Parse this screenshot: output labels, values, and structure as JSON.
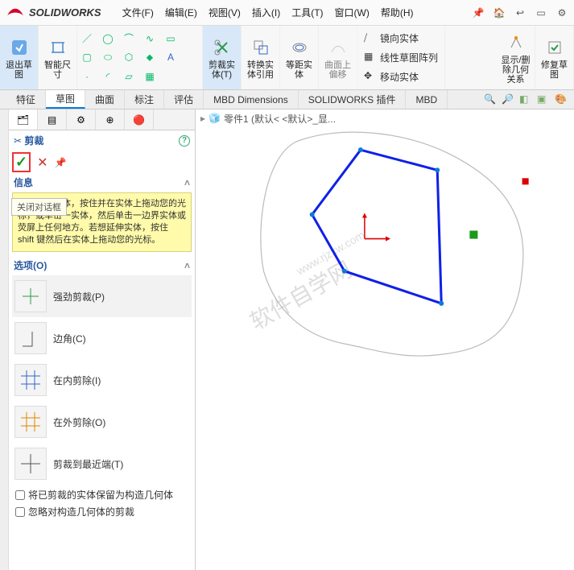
{
  "title": {
    "brand": "SOLIDWORKS"
  },
  "menus": [
    "文件(F)",
    "编辑(E)",
    "视图(V)",
    "插入(I)",
    "工具(T)",
    "窗口(W)",
    "帮助(H)"
  ],
  "ribbon": {
    "exit_sketch": "退出草图",
    "smart_dim": "智能尺寸",
    "trim": "剪裁实体(T)",
    "convert": "转换实体引用",
    "offset": "等距实体",
    "curve": "曲面上偏移",
    "mirror": "镜向实体",
    "pattern": "线性草图阵列",
    "move": "移动实体",
    "show_rel": "显示/删除几何关系",
    "repair": "修复草图"
  },
  "cmd_tabs": [
    "特征",
    "草图",
    "曲面",
    "标注",
    "评估",
    "MBD Dimensions",
    "SOLIDWORKS 插件",
    "MBD"
  ],
  "crumb": "零件1  (默认< <默认>_显...",
  "feature": {
    "name": "剪裁",
    "tooltip": "关闭对话框",
    "msg_label": "信息",
    "msg": "若想剪裁实体，按住并在实体上拖动您的光标，或单击一实体，然后单击一边界实体或荧屏上任何地方。若想延伸实体，按住 shift 键然后在实体上拖动您的光标。",
    "opts_label": "选项(O)",
    "opts": [
      {
        "label": "强劲剪裁(P)"
      },
      {
        "label": "边角(C)"
      },
      {
        "label": "在内剪除(I)"
      },
      {
        "label": "在外剪除(O)"
      },
      {
        "label": "剪裁到最近端(T)"
      }
    ],
    "cb1": "将已剪裁的实体保留为构造几何体",
    "cb2": "忽略对构造几何体的剪裁"
  }
}
